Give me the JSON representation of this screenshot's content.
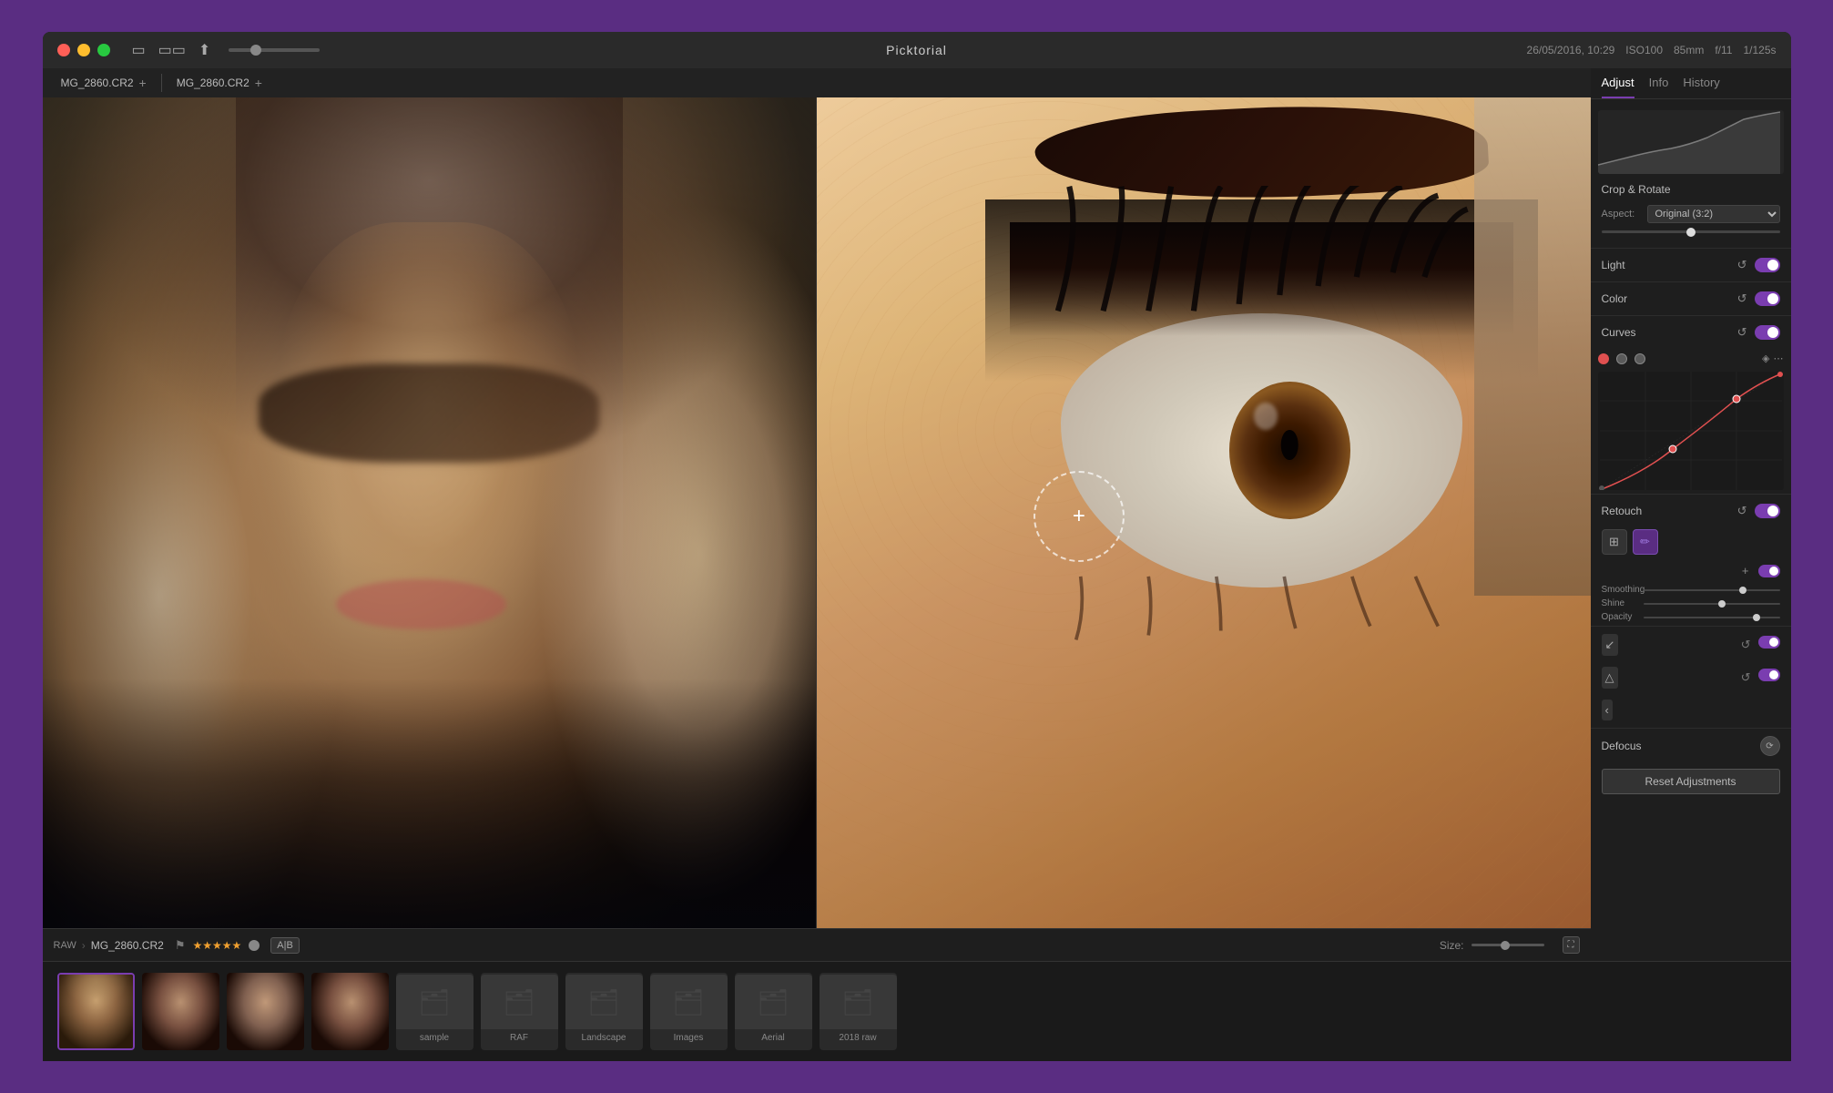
{
  "app": {
    "title": "Picktorial",
    "window_title": "Picktorial"
  },
  "titlebar": {
    "date_time": "26/05/2016, 10:29",
    "iso": "ISO100",
    "focal": "85mm",
    "aperture": "f/11",
    "shutter": "1/125s"
  },
  "tabs_left": {
    "tab1_label": "MG_2860.CR2",
    "tab2_label": "MG_2860.CR2"
  },
  "status_bar": {
    "raw_label": "RAW",
    "filename": "MG_2860.CR2",
    "stars": "★★★★★",
    "ab_label": "A|B",
    "size_label": "Size:"
  },
  "right_panel": {
    "tab_adjust": "Adjust",
    "tab_info": "Info",
    "tab_history": "History",
    "active_tab": "Adjust",
    "sections": {
      "crop_rotate": {
        "title": "Crop & Rotate",
        "aspect_label": "Aspect:",
        "aspect_value": "Original (3:2)"
      },
      "light": {
        "title": "Light"
      },
      "color": {
        "title": "Color"
      },
      "curves": {
        "title": "Curves"
      },
      "retouch": {
        "title": "Retouch"
      },
      "defocus": {
        "label": "Defocus"
      }
    },
    "sliders": {
      "smoothing_label": "Smoothing",
      "shine_label": "Shine",
      "opacity_label": "Opacity"
    },
    "reset_label": "Reset Adjustments"
  },
  "filmstrip": {
    "folders": [
      {
        "label": "sample",
        "type": "folder"
      },
      {
        "label": "RAF",
        "type": "folder"
      },
      {
        "label": "Landscape",
        "type": "folder"
      },
      {
        "label": "Images",
        "type": "folder"
      },
      {
        "label": "Aerial",
        "type": "folder"
      },
      {
        "label": "2018 raw",
        "type": "folder"
      }
    ],
    "thumbs_count": 4
  },
  "icons": {
    "reset": "↺",
    "enable": "●",
    "add": "+",
    "settings": "⚙",
    "close": "✕",
    "chevron_down": "▾",
    "chevron_left": "‹",
    "layers": "⊞",
    "brush": "✏",
    "eraser": "◻",
    "arrow": "↗"
  }
}
